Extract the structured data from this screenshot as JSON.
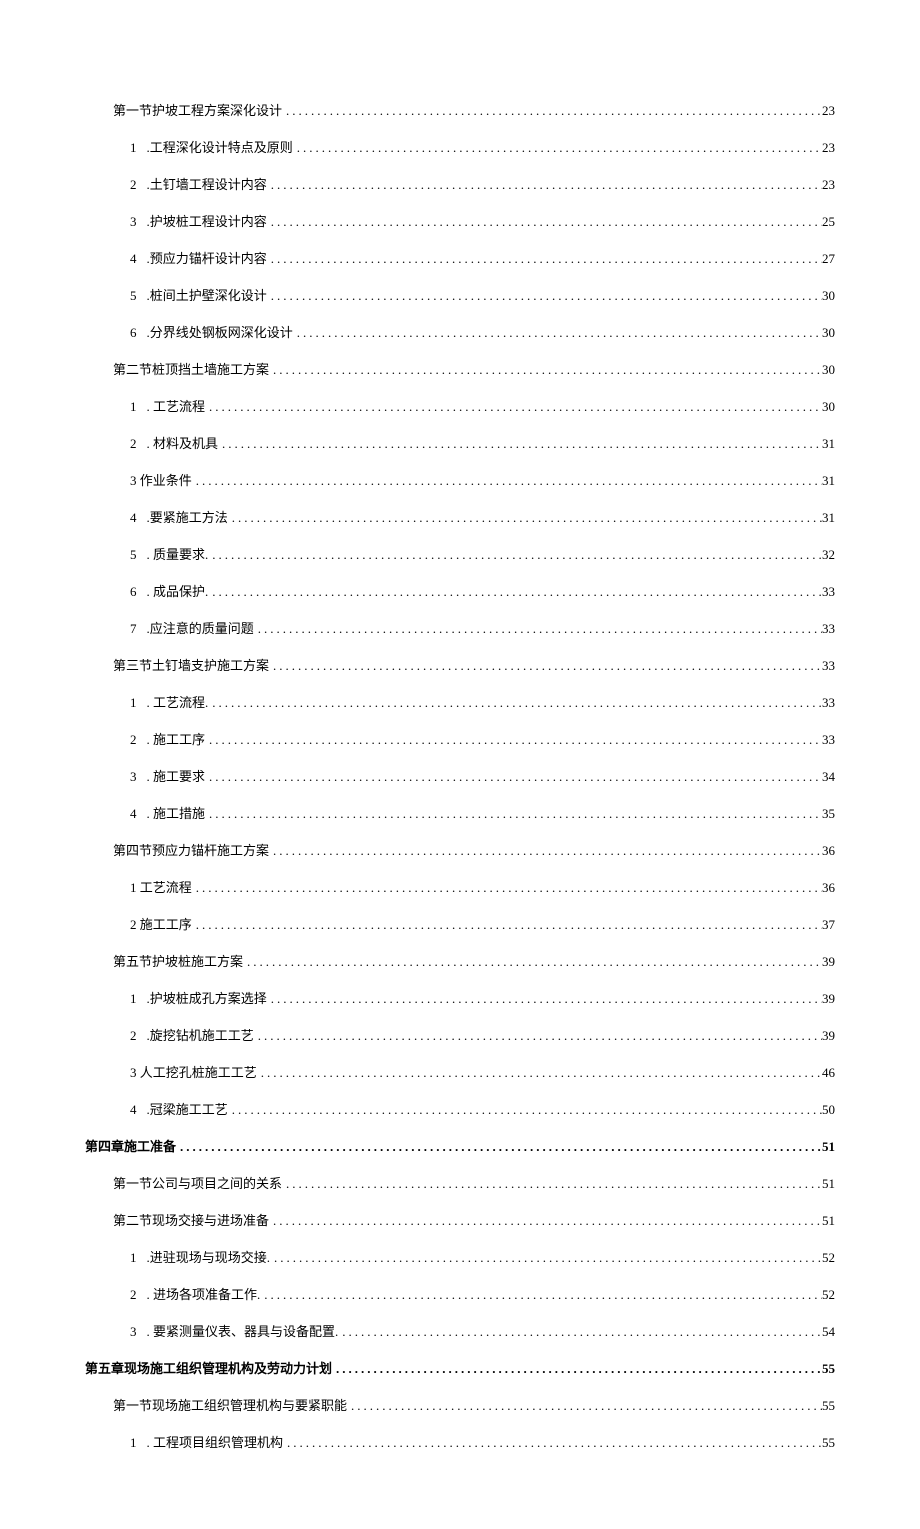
{
  "toc": [
    {
      "level": 2,
      "num": "",
      "text": "第一节护坡工程方案深化设计",
      "page": "23"
    },
    {
      "level": 3,
      "num": "1",
      "text": ".工程深化设计特点及原则",
      "page": "23"
    },
    {
      "level": 3,
      "num": "2",
      "text": ".土钉墙工程设计内容",
      "page": "23"
    },
    {
      "level": 3,
      "num": "3",
      "text": ".护坡桩工程设计内容",
      "page": "25"
    },
    {
      "level": 3,
      "num": "4",
      "text": ".预应力锚杆设计内容",
      "page": "27"
    },
    {
      "level": 3,
      "num": "5",
      "text": ".桩间土护壁深化设计",
      "page": "30"
    },
    {
      "level": 3,
      "num": "6",
      "text": ".分界线处钢板网深化设计",
      "page": "30"
    },
    {
      "level": 2,
      "num": "",
      "text": "第二节桩顶挡土墙施工方案",
      "page": "30"
    },
    {
      "level": 3,
      "num": "1",
      "text": ". 工艺流程",
      "page": "30"
    },
    {
      "level": 3,
      "num": "2",
      "text": ". 材料及机具",
      "page": "31"
    },
    {
      "level": 3,
      "num": "",
      "text": "3 作业条件",
      "page": "31"
    },
    {
      "level": 3,
      "num": "4",
      "text": ".要紧施工方法",
      "page": "31"
    },
    {
      "level": 3,
      "num": "5",
      "text": ". 质量要求.",
      "page": "32"
    },
    {
      "level": 3,
      "num": "6",
      "text": ". 成品保护.",
      "page": "33"
    },
    {
      "level": 3,
      "num": "7",
      "text": ".应注意的质量问题",
      "page": "33"
    },
    {
      "level": 2,
      "num": "",
      "text": "第三节土钉墙支护施工方案",
      "page": "33"
    },
    {
      "level": 3,
      "num": "1",
      "text": ". 工艺流程.",
      "page": "33"
    },
    {
      "level": 3,
      "num": "2",
      "text": ". 施工工序",
      "page": "33"
    },
    {
      "level": 3,
      "num": "3",
      "text": ". 施工要求",
      "page": "34"
    },
    {
      "level": 3,
      "num": "4",
      "text": ". 施工措施",
      "page": "35"
    },
    {
      "level": 2,
      "num": "",
      "text": "第四节预应力锚杆施工方案",
      "page": "36"
    },
    {
      "level": 3,
      "num": "",
      "text": "1 工艺流程",
      "page": "36"
    },
    {
      "level": 3,
      "num": "",
      "text": "2 施工工序",
      "page": "37"
    },
    {
      "level": 2,
      "num": "",
      "text": "第五节护坡桩施工方案",
      "page": "39"
    },
    {
      "level": 3,
      "num": "1",
      "text": ".护坡桩成孔方案选择",
      "page": "39"
    },
    {
      "level": 3,
      "num": "2",
      "text": ".旋挖钻机施工工艺",
      "page": "39"
    },
    {
      "level": 3,
      "num": "",
      "text": "3 人工挖孔桩施工工艺",
      "page": "46"
    },
    {
      "level": 3,
      "num": "4",
      "text": ".冠梁施工工艺",
      "page": "50"
    },
    {
      "level": 1,
      "num": "",
      "text": "第四章施工准备",
      "page": "51"
    },
    {
      "level": 2,
      "num": "",
      "text": "第一节公司与项目之间的关系",
      "page": "51"
    },
    {
      "level": 2,
      "num": "",
      "text": "第二节现场交接与进场准备",
      "page": "51"
    },
    {
      "level": 3,
      "num": "1",
      "text": ".进驻现场与现场交接.",
      "page": "52"
    },
    {
      "level": 3,
      "num": "2",
      "text": ". 进场各项准备工作.",
      "page": "52"
    },
    {
      "level": 3,
      "num": "3",
      "text": ". 要紧测量仪表、器具与设备配置.",
      "page": "54"
    },
    {
      "level": 1,
      "num": "",
      "text": "第五章现场施工组织管理机构及劳动力计划",
      "page": "55"
    },
    {
      "level": 2,
      "num": "",
      "text": "第一节现场施工组织管理机构与要紧职能",
      "page": "55"
    },
    {
      "level": 3,
      "num": "1",
      "text": ". 工程项目组织管理机构",
      "page": "55"
    }
  ]
}
